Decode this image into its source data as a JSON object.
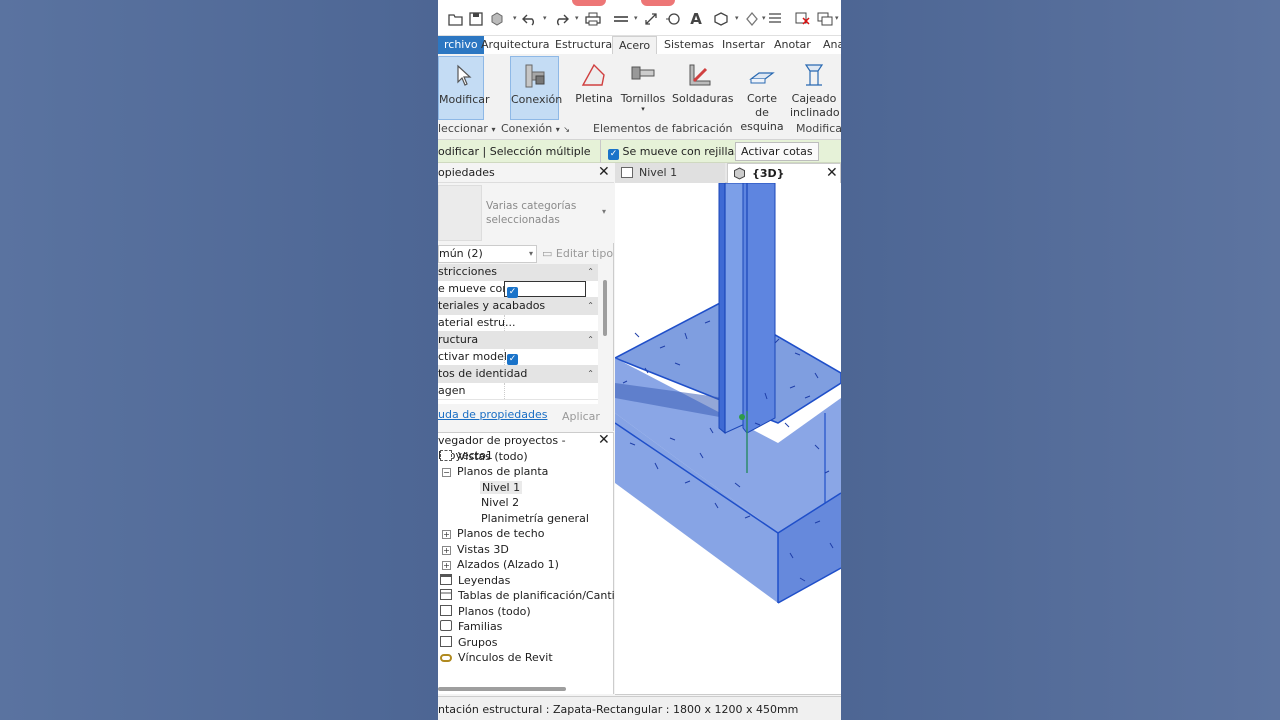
{
  "quick_access": {
    "icons": [
      "open-icon",
      "save-icon",
      "sync-icon",
      "undo-icon",
      "redo-icon",
      "print-icon",
      "measure-icon",
      "align-dimension-icon",
      "tag-icon",
      "text-icon",
      "default-3d-icon",
      "section-icon",
      "thin-lines-icon",
      "close-hidden-icon",
      "switch-windows-icon"
    ]
  },
  "ribbon_tabs": [
    "rchivo",
    "Arquitectura",
    "Estructura",
    "Acero",
    "Sistemas",
    "Insertar",
    "Anotar",
    "Ana"
  ],
  "active_tab": "Acero",
  "ribbon": {
    "buttons": {
      "modificar": "Modificar",
      "conexion": "Conexión",
      "pletina": "Pletina",
      "tornillos": "Tornillos",
      "soldaduras": "Soldaduras",
      "corte_esquina_1": "Corte",
      "corte_esquina_2": "de esquina",
      "cajeado_1": "Cajeado",
      "cajeado_2": "inclinado"
    },
    "panels": {
      "seleccionar": "leccionar",
      "conexion": "Conexión",
      "fabricacion": "Elementos de fabricación",
      "modificar": "Modificac"
    }
  },
  "options_bar": {
    "context": "odificar | Selección múltiple",
    "move_with_grids": "Se mueve con rejillas",
    "activate_dims": "Activar cotas"
  },
  "properties": {
    "title": "opiedades",
    "type_selector": "Varias categorías seleccionadas",
    "filter": "mún (2)",
    "edit_type": "Editar tipo",
    "rows": [
      {
        "kind": "cat",
        "label": "stricciones"
      },
      {
        "kind": "prop",
        "label": "e mueve con ...",
        "checked": true
      },
      {
        "kind": "cat",
        "label": "teriales y acabados"
      },
      {
        "kind": "prop",
        "label": "aterial estru...",
        "value": ""
      },
      {
        "kind": "cat",
        "label": "ructura"
      },
      {
        "kind": "prop",
        "label": "ctivar model...",
        "checked": true
      },
      {
        "kind": "cat",
        "label": "tos de identidad"
      },
      {
        "kind": "prop",
        "label": "agen",
        "value": ""
      }
    ],
    "help_link": "uda de propiedades",
    "apply": "Aplicar"
  },
  "browser": {
    "title": "vegador de proyectos - Proyecto1",
    "nodes": {
      "vistas": "Vistas (todo)",
      "planos_planta": "Planos de planta",
      "nivel1": "Nivel 1",
      "nivel2": "Nivel 2",
      "planimetria": "Planimetría general",
      "planos_techo": "Planos de techo",
      "vistas3d": "Vistas 3D",
      "alzados": "Alzados (Alzado 1)",
      "leyendas": "Leyendas",
      "tablas": "Tablas de planificación/Cantidad",
      "planos": "Planos (todo)",
      "familias": "Familias",
      "grupos": "Grupos",
      "vinculos": "Vínculos de Revit"
    }
  },
  "view_tabs": {
    "inactive": "Nivel 1",
    "active": "{3D}"
  },
  "status_bar": "ntación estructural : Zapata-Rectangular : 1800 x 1200 x 450mm",
  "colors": {
    "file_tab": "#2c77c2",
    "selection_blue": "#1f5ed6",
    "options_bar_bg": "#e6f2d8"
  }
}
